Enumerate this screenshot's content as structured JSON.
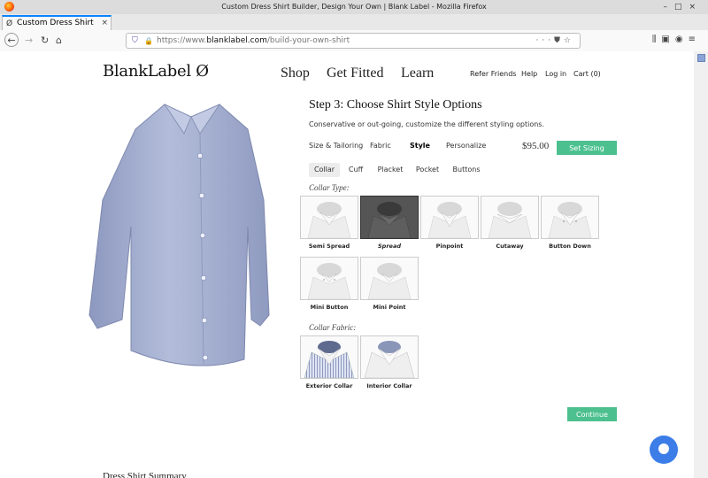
{
  "browser": {
    "window_title": "Custom Dress Shirt Builder, Design Your Own | Blank Label - Mozilla Firefox",
    "tab_title": "Custom Dress Shirt",
    "tab_close": "×",
    "new_tab": "+",
    "url_prefix": "https://www.",
    "url_domain": "blanklabel.com",
    "url_path": "/build-your-own-shirt",
    "url_menu": "···",
    "window_controls": "–□×"
  },
  "site": {
    "logo": "BlankLabel Ø",
    "main_nav": [
      "Shop",
      "Get Fitted",
      "Learn"
    ],
    "top_links": {
      "refer": "Refer Friends",
      "help": "Help",
      "login": "Log in",
      "cart": "Cart (0)"
    }
  },
  "builder": {
    "title": "Step 3: Choose Shirt Style Options",
    "subtitle": "Conservative or out-going, customize the different styling options.",
    "steps": [
      "Size & Tailoring",
      "Fabric",
      "Style",
      "Personalize"
    ],
    "active_step": "Style",
    "price": "$95.00",
    "set_sizing": "Set Sizing",
    "subtabs": [
      "Collar",
      "Cuff",
      "Placket",
      "Pocket",
      "Buttons"
    ],
    "active_subtab": "Collar",
    "collar_type_label": "Collar Type:",
    "collar_types": [
      "Semi Spread",
      "Spread",
      "Pinpoint",
      "Cutaway",
      "Button Down",
      "Mini Button",
      "Mini Point"
    ],
    "selected_collar": "Spread",
    "collar_fabric_label": "Collar Fabric:",
    "collar_fabrics": [
      "Exterior Collar",
      "Interior Collar"
    ],
    "continue": "Continue"
  },
  "summary_title": "Dress Shirt Summary",
  "colors": {
    "accent_green": "#4cc08f",
    "chat_blue": "#3c7de8",
    "shirt": "#a9b4d4"
  }
}
